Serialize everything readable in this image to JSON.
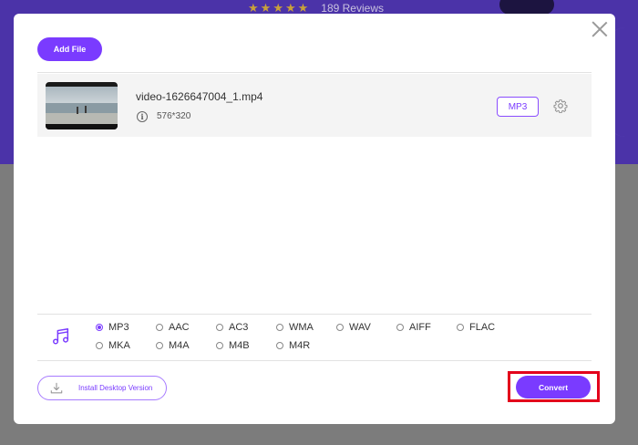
{
  "background": {
    "rating_stars": 5,
    "reviews_label": "189 Reviews"
  },
  "dialog": {
    "add_file_label": "Add File",
    "close_icon": "close-icon",
    "file": {
      "name": "video-1626647004_1.mp4",
      "resolution": "576*320",
      "output_format": "MP3",
      "info_icon": "info-icon",
      "settings_icon": "gear-icon"
    },
    "formats": {
      "selected": "MP3",
      "row1": [
        "MP3",
        "AAC",
        "AC3",
        "WMA",
        "WAV",
        "AIFF",
        "FLAC"
      ],
      "row2": [
        "MKA",
        "M4A",
        "M4B",
        "M4R"
      ],
      "icon": "music-note-icon"
    },
    "footer": {
      "install_label": "Install Desktop Version",
      "install_icon": "download-icon",
      "convert_label": "Convert"
    }
  },
  "colors": {
    "accent": "#7a3bff",
    "highlight_box": "#e3001b",
    "header_bg": "#4b33a8"
  }
}
